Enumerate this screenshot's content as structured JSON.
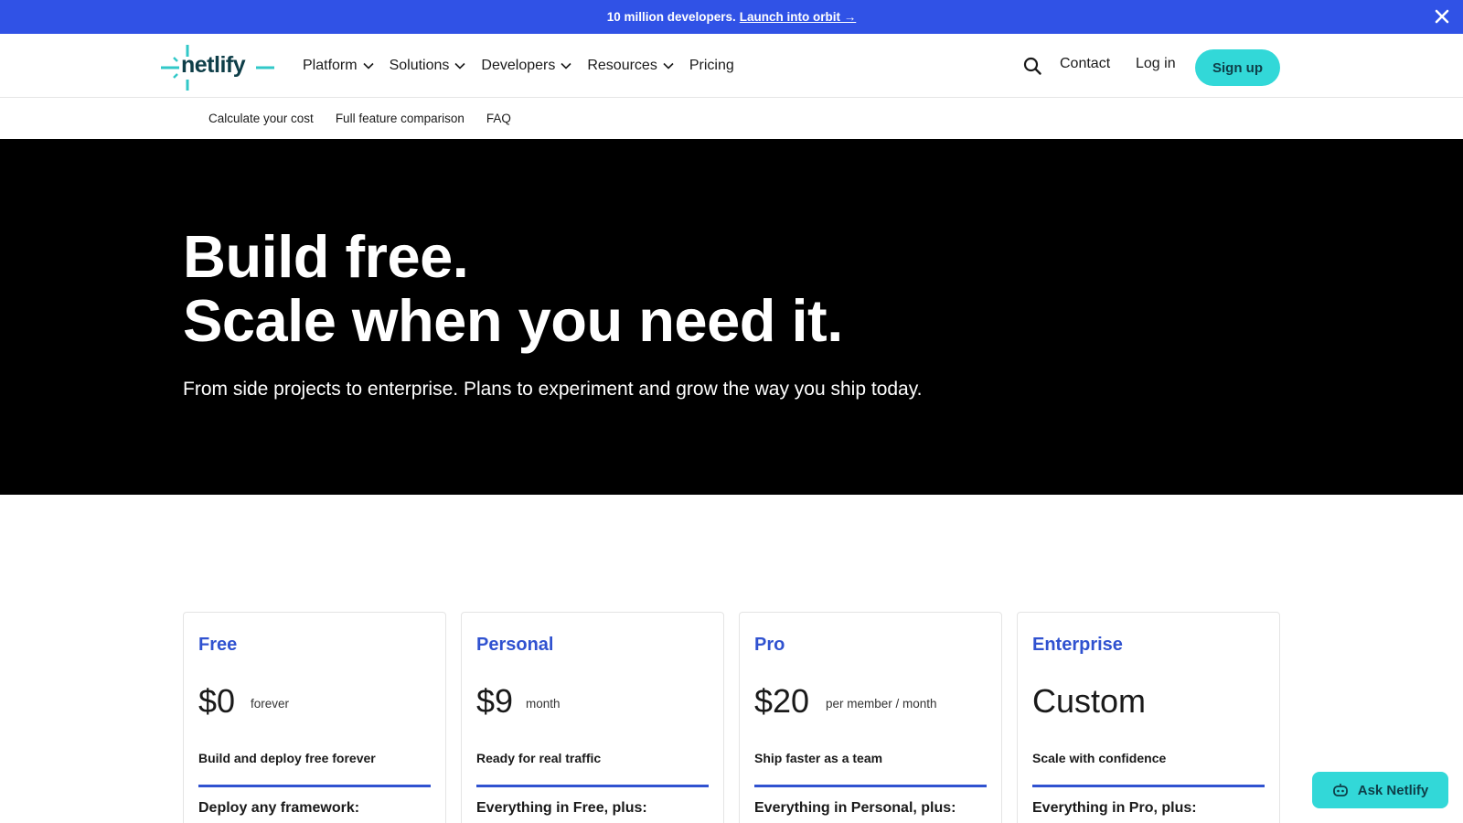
{
  "announcement": {
    "text": "10 million developers.",
    "link_label": "Launch into orbit →"
  },
  "brand": {
    "name": "netlify",
    "accent": "#32d8d8",
    "blue": "#3052e6"
  },
  "nav": {
    "items": [
      {
        "label": "Platform",
        "dropdown": true
      },
      {
        "label": "Solutions",
        "dropdown": true
      },
      {
        "label": "Developers",
        "dropdown": true
      },
      {
        "label": "Resources",
        "dropdown": true
      },
      {
        "label": "Pricing",
        "dropdown": false
      }
    ],
    "contact_label": "Contact",
    "login_label": "Log in",
    "signup_label": "Sign up"
  },
  "subnav": {
    "items": [
      "Calculate your cost",
      "Full feature comparison",
      "FAQ"
    ]
  },
  "hero": {
    "title_line1": "Build free.",
    "title_line2": "Scale when you need it.",
    "subtitle": "From side projects to enterprise. Plans to experiment and grow the way you ship today."
  },
  "plans": [
    {
      "name": "Free",
      "price": "$0",
      "unit": "forever",
      "tagline": "Build and deploy free forever",
      "features_heading": "Deploy any framework:"
    },
    {
      "name": "Personal",
      "price": "$9",
      "unit": "month",
      "tagline": "Ready for real traffic",
      "features_heading": "Everything in Free, plus:"
    },
    {
      "name": "Pro",
      "price": "$20",
      "unit": "per member / month",
      "tagline": "Ship faster as a team",
      "features_heading": "Everything in Personal, plus:"
    },
    {
      "name": "Enterprise",
      "price": "Custom",
      "unit": "",
      "tagline": "Scale with confidence",
      "features_heading": "Everything in Pro, plus:"
    }
  ],
  "assistant": {
    "label": "Ask Netlify"
  }
}
